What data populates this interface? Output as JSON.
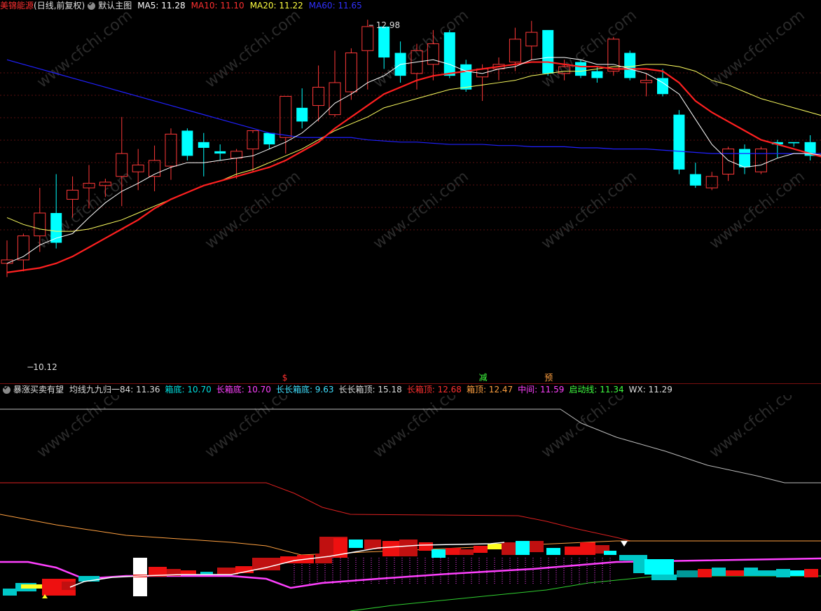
{
  "main_header": {
    "stock_name": "美锦能源",
    "mode": "(日线,前复权)",
    "template": "默认主图",
    "ma5_label": "MA5: 11.28",
    "ma10_label": "MA10: 11.10",
    "ma20_label": "MA20: 11.22",
    "ma60_label": "MA60: 11.65"
  },
  "sub_header": {
    "indicator": "暴涨买卖有望",
    "items": [
      {
        "label": "均线九九归一84: 11.36",
        "color": "#dddddd"
      },
      {
        "label": "箱底: 10.70",
        "color": "#00e0e0"
      },
      {
        "label": "长箱底: 10.70",
        "color": "#ff40ff"
      },
      {
        "label": "长长箱底: 9.63",
        "color": "#40e0ff"
      },
      {
        "label": "长长箱顶: 15.18",
        "color": "#dddddd"
      },
      {
        "label": "长箱顶: 12.68",
        "color": "#ff3030"
      },
      {
        "label": "箱顶: 12.47",
        "color": "#ffa040"
      },
      {
        "label": "中间: 11.59",
        "color": "#ff40ff"
      },
      {
        "label": "启动线: 11.34",
        "color": "#40ff40"
      },
      {
        "label": "WX: 11.29",
        "color": "#dddddd"
      }
    ]
  },
  "colors": {
    "up": "#ff3838",
    "down": "#00ffff",
    "ma5": "#ffffff",
    "ma10": "#ff2020",
    "ma20": "#ffff60",
    "ma60": "#2020ff",
    "grid": "#5a1010",
    "bg": "#000000"
  },
  "chart_data": {
    "type": "candlestick",
    "ylim": [
      10.0,
      13.1
    ],
    "candles": [
      {
        "o": 10.92,
        "h": 11.12,
        "l": 10.8,
        "c": 10.95
      },
      {
        "o": 10.95,
        "h": 11.18,
        "l": 10.85,
        "c": 11.16
      },
      {
        "o": 11.16,
        "h": 11.58,
        "l": 11.02,
        "c": 11.36
      },
      {
        "o": 11.36,
        "h": 11.7,
        "l": 11.05,
        "c": 11.1
      },
      {
        "o": 11.48,
        "h": 11.68,
        "l": 11.32,
        "c": 11.56
      },
      {
        "o": 11.58,
        "h": 11.78,
        "l": 11.4,
        "c": 11.62
      },
      {
        "o": 11.6,
        "h": 11.66,
        "l": 11.5,
        "c": 11.63
      },
      {
        "o": 11.68,
        "h": 12.2,
        "l": 11.42,
        "c": 11.88
      },
      {
        "o": 11.72,
        "h": 11.92,
        "l": 11.56,
        "c": 11.78
      },
      {
        "o": 11.68,
        "h": 11.95,
        "l": 11.55,
        "c": 11.82
      },
      {
        "o": 11.77,
        "h": 12.1,
        "l": 11.65,
        "c": 12.05
      },
      {
        "o": 12.08,
        "h": 12.1,
        "l": 11.82,
        "c": 11.86
      },
      {
        "o": 11.98,
        "h": 12.06,
        "l": 11.68,
        "c": 11.93
      },
      {
        "o": 11.9,
        "h": 11.96,
        "l": 11.82,
        "c": 11.88
      },
      {
        "o": 11.84,
        "h": 11.92,
        "l": 11.66,
        "c": 11.9
      },
      {
        "o": 11.92,
        "h": 12.06,
        "l": 11.72,
        "c": 12.08
      },
      {
        "o": 12.06,
        "h": 12.06,
        "l": 11.92,
        "c": 11.96
      },
      {
        "o": 12.02,
        "h": 12.38,
        "l": 11.88,
        "c": 12.38
      },
      {
        "o": 12.28,
        "h": 12.45,
        "l": 12.1,
        "c": 12.16
      },
      {
        "o": 12.3,
        "h": 12.65,
        "l": 12.16,
        "c": 12.46
      },
      {
        "o": 12.22,
        "h": 12.78,
        "l": 12.2,
        "c": 12.5
      },
      {
        "o": 12.42,
        "h": 12.8,
        "l": 12.35,
        "c": 12.76
      },
      {
        "o": 12.78,
        "h": 13.05,
        "l": 12.44,
        "c": 12.99
      },
      {
        "o": 12.99,
        "h": 12.99,
        "l": 12.62,
        "c": 12.72
      },
      {
        "o": 12.76,
        "h": 12.86,
        "l": 12.5,
        "c": 12.56
      },
      {
        "o": 12.58,
        "h": 12.84,
        "l": 12.44,
        "c": 12.78
      },
      {
        "o": 12.66,
        "h": 12.96,
        "l": 12.52,
        "c": 12.84
      },
      {
        "o": 12.94,
        "h": 12.96,
        "l": 12.54,
        "c": 12.56
      },
      {
        "o": 12.66,
        "h": 12.7,
        "l": 12.42,
        "c": 12.44
      },
      {
        "o": 12.55,
        "h": 12.66,
        "l": 12.34,
        "c": 12.62
      },
      {
        "o": 12.62,
        "h": 12.72,
        "l": 12.52,
        "c": 12.66
      },
      {
        "o": 12.68,
        "h": 12.98,
        "l": 12.6,
        "c": 12.88
      },
      {
        "o": 12.82,
        "h": 13.04,
        "l": 12.7,
        "c": 12.94
      },
      {
        "o": 12.96,
        "h": 12.96,
        "l": 12.56,
        "c": 12.58
      },
      {
        "o": 12.58,
        "h": 12.7,
        "l": 12.52,
        "c": 12.64
      },
      {
        "o": 12.68,
        "h": 12.7,
        "l": 12.54,
        "c": 12.56
      },
      {
        "o": 12.6,
        "h": 12.64,
        "l": 12.5,
        "c": 12.54
      },
      {
        "o": 12.6,
        "h": 12.9,
        "l": 12.56,
        "c": 12.88
      },
      {
        "o": 12.76,
        "h": 12.78,
        "l": 12.52,
        "c": 12.54
      },
      {
        "o": 12.5,
        "h": 12.58,
        "l": 12.38,
        "c": 12.52
      },
      {
        "o": 12.54,
        "h": 12.62,
        "l": 12.38,
        "c": 12.4
      },
      {
        "o": 12.22,
        "h": 12.26,
        "l": 11.7,
        "c": 11.74
      },
      {
        "o": 11.7,
        "h": 11.8,
        "l": 11.58,
        "c": 11.6
      },
      {
        "o": 11.58,
        "h": 11.72,
        "l": 11.56,
        "c": 11.68
      },
      {
        "o": 11.7,
        "h": 11.94,
        "l": 11.64,
        "c": 11.92
      },
      {
        "o": 11.92,
        "h": 11.96,
        "l": 11.7,
        "c": 11.76
      },
      {
        "o": 11.72,
        "h": 11.94,
        "l": 11.7,
        "c": 11.92
      },
      {
        "o": 11.98,
        "h": 12.0,
        "l": 11.84,
        "c": 11.96
      },
      {
        "o": 11.98,
        "h": 11.98,
        "l": 11.94,
        "c": 11.97
      },
      {
        "o": 11.98,
        "h": 12.04,
        "l": 11.82,
        "c": 11.86
      },
      {
        "o": 11.84,
        "h": 11.88,
        "l": 11.66,
        "c": 11.74
      },
      {
        "o": 11.76,
        "h": 11.96,
        "l": 11.66,
        "c": 11.92
      }
    ],
    "ma5": [
      10.92,
      10.98,
      11.08,
      11.14,
      11.18,
      11.32,
      11.45,
      11.55,
      11.62,
      11.7,
      11.76,
      11.8,
      11.8,
      11.82,
      11.84,
      11.86,
      11.92,
      11.98,
      12.06,
      12.18,
      12.32,
      12.4,
      12.5,
      12.56,
      12.66,
      12.68,
      12.7,
      12.66,
      12.6,
      12.58,
      12.62,
      12.64,
      12.7,
      12.72,
      12.72,
      12.7,
      12.66,
      12.66,
      12.62,
      12.58,
      12.5,
      12.4,
      12.18,
      11.96,
      11.82,
      11.76,
      11.78,
      11.84,
      11.88,
      11.88,
      11.86,
      11.86
    ],
    "ma10": [
      10.84,
      10.86,
      10.88,
      10.92,
      10.98,
      11.06,
      11.14,
      11.22,
      11.3,
      11.4,
      11.48,
      11.54,
      11.6,
      11.64,
      11.68,
      11.72,
      11.76,
      11.82,
      11.9,
      11.98,
      12.1,
      12.2,
      12.3,
      12.4,
      12.46,
      12.52,
      12.56,
      12.58,
      12.6,
      12.62,
      12.64,
      12.66,
      12.68,
      12.68,
      12.66,
      12.64,
      12.64,
      12.62,
      12.62,
      12.62,
      12.6,
      12.5,
      12.34,
      12.24,
      12.16,
      12.08,
      12.0,
      11.96,
      11.92,
      11.88,
      11.84,
      11.82
    ],
    "ma20": [
      11.32,
      11.26,
      11.22,
      11.2,
      11.2,
      11.22,
      11.26,
      11.3,
      11.36,
      11.42,
      11.48,
      11.54,
      11.6,
      11.64,
      11.7,
      11.74,
      11.8,
      11.86,
      11.92,
      12.0,
      12.08,
      12.14,
      12.2,
      12.28,
      12.32,
      12.36,
      12.4,
      12.44,
      12.46,
      12.48,
      12.5,
      12.52,
      12.56,
      12.58,
      12.6,
      12.6,
      12.62,
      12.64,
      12.64,
      12.66,
      12.66,
      12.64,
      12.6,
      12.52,
      12.48,
      12.42,
      12.36,
      12.32,
      12.28,
      12.24,
      12.2,
      12.16
    ],
    "ma60": [
      12.7,
      12.66,
      12.62,
      12.58,
      12.54,
      12.5,
      12.46,
      12.42,
      12.38,
      12.34,
      12.3,
      12.26,
      12.22,
      12.18,
      12.14,
      12.1,
      12.06,
      12.04,
      12.02,
      12.02,
      12.02,
      12.02,
      12.0,
      11.99,
      11.98,
      11.98,
      11.97,
      11.96,
      11.96,
      11.96,
      11.95,
      11.95,
      11.94,
      11.94,
      11.94,
      11.93,
      11.93,
      11.92,
      11.92,
      11.92,
      11.91,
      11.9,
      11.89,
      11.88,
      11.88,
      11.88,
      11.88,
      11.88,
      11.88,
      11.88,
      11.88,
      11.88
    ],
    "annotations": {
      "high_label": "12.98",
      "low_label": "10.12",
      "signals": [
        {
          "text": "$",
          "index": 17,
          "color": "#ff3030"
        },
        {
          "text": "减",
          "index": 29,
          "color": "#40ff40"
        },
        {
          "text": "预",
          "index": 33,
          "color": "#ffa040"
        }
      ]
    }
  },
  "watermark_text": "www.cfchi.com"
}
